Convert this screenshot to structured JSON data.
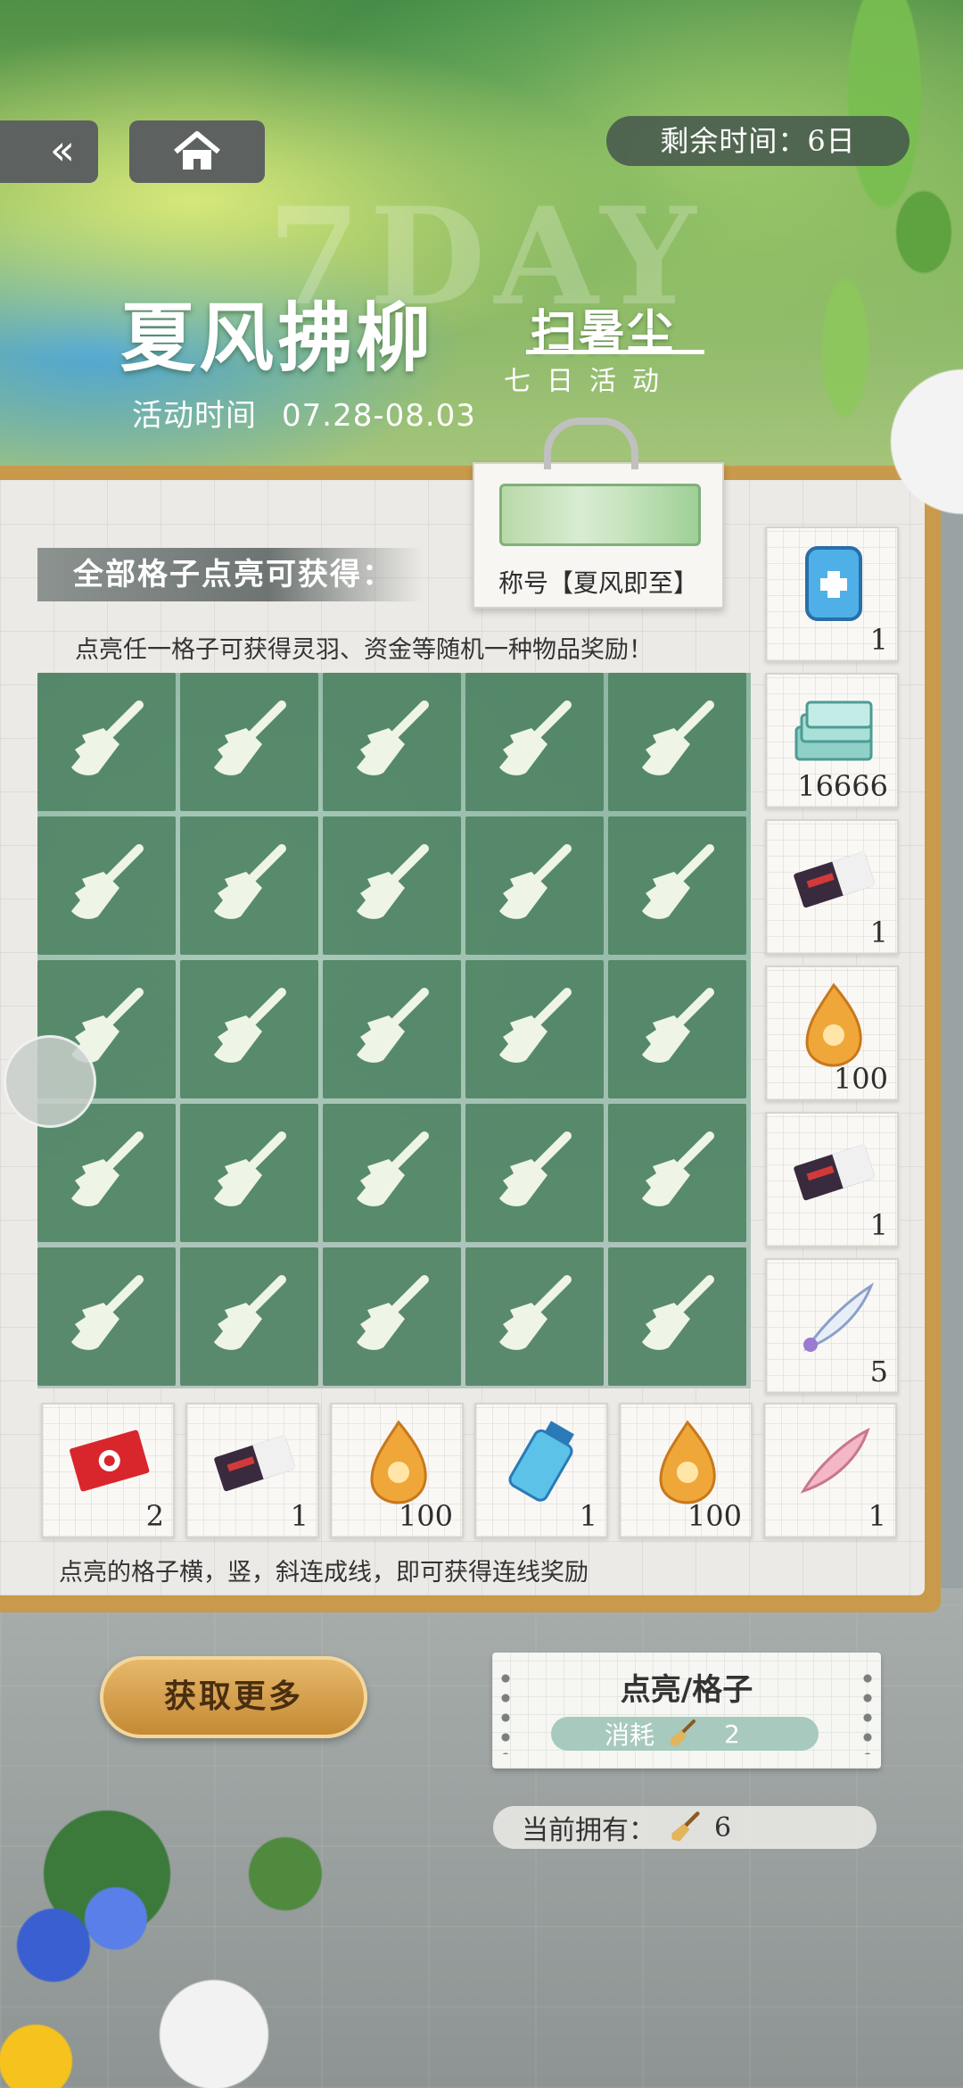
{
  "header": {
    "timer_label": "剩余时间：6日",
    "title_main": "夏风拂柳",
    "title_side": "扫暑尘",
    "title_sub": "七日活动",
    "event_time_label": "活动时间",
    "event_time_range": "07.28-08.03",
    "watermark": "7DAY"
  },
  "board": {
    "title_reward_label": "称号【夏风即至】",
    "all_lit_label": "全部格子点亮可获得：",
    "hint_top": "点亮任一格子可获得灵羽、资金等随机一种物品奖励！",
    "hint_bottom": "点亮的格子横，竖，斜连成线，即可获得连线奖励",
    "grid_rows": 5,
    "grid_cols": 5,
    "cell_icon": "broom-icon"
  },
  "row_rewards": [
    {
      "icon": "iv-bag-icon",
      "qty": "1"
    },
    {
      "icon": "money-stack-icon",
      "qty": "16666"
    },
    {
      "icon": "ticket-icon",
      "qty": "1"
    },
    {
      "icon": "amber-gem-icon",
      "qty": "100"
    },
    {
      "icon": "ticket-icon",
      "qty": "1"
    },
    {
      "icon": "feather-icon",
      "qty": "5"
    }
  ],
  "col_rewards": [
    {
      "icon": "red-card-icon",
      "qty": "2"
    },
    {
      "icon": "ticket-icon",
      "qty": "1"
    },
    {
      "icon": "amber-gem-icon",
      "qty": "100"
    },
    {
      "icon": "potion-bottle-icon",
      "qty": "1"
    },
    {
      "icon": "amber-gem-icon",
      "qty": "100"
    },
    {
      "icon": "pink-feather-icon",
      "qty": "1"
    }
  ],
  "controls": {
    "get_more_label": "获取更多",
    "cost_title": "点亮/格子",
    "cost_label": "消耗",
    "cost_amount": "2",
    "owned_label": "当前拥有：",
    "owned_amount": "6"
  },
  "colors": {
    "cell_green": "#4a805f",
    "board_gold": "#c99a4b",
    "button_gold": "#c48a34",
    "cost_teal": "#a8c9bd"
  }
}
